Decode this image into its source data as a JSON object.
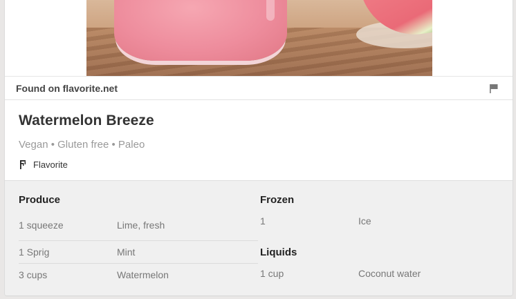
{
  "found_bar": {
    "text": "Found on flavorite.net",
    "flag_icon": "flag-icon"
  },
  "recipe": {
    "title": "Watermelon Breeze",
    "tags": "Vegan • Gluten free • Paleo",
    "source_icon": "flavorite-logo-icon",
    "source": "Flavorite"
  },
  "ingredients": {
    "produce": {
      "title": "Produce",
      "items": [
        {
          "qty": "1 squeeze",
          "name": "Lime, fresh"
        },
        {
          "qty": "1 Sprig",
          "name": "Mint"
        },
        {
          "qty": "3 cups",
          "name": "Watermelon"
        }
      ]
    },
    "frozen": {
      "title": "Frozen",
      "items": [
        {
          "qty": "1",
          "name": "Ice"
        }
      ]
    },
    "liquids": {
      "title": "Liquids",
      "items": [
        {
          "qty": "1 cup",
          "name": "Coconut water"
        }
      ]
    }
  },
  "colors": {
    "background": "#e9e7e6",
    "card": "#ffffff",
    "ingredients_bg": "#f0f0f0",
    "tag_text": "#999999"
  }
}
